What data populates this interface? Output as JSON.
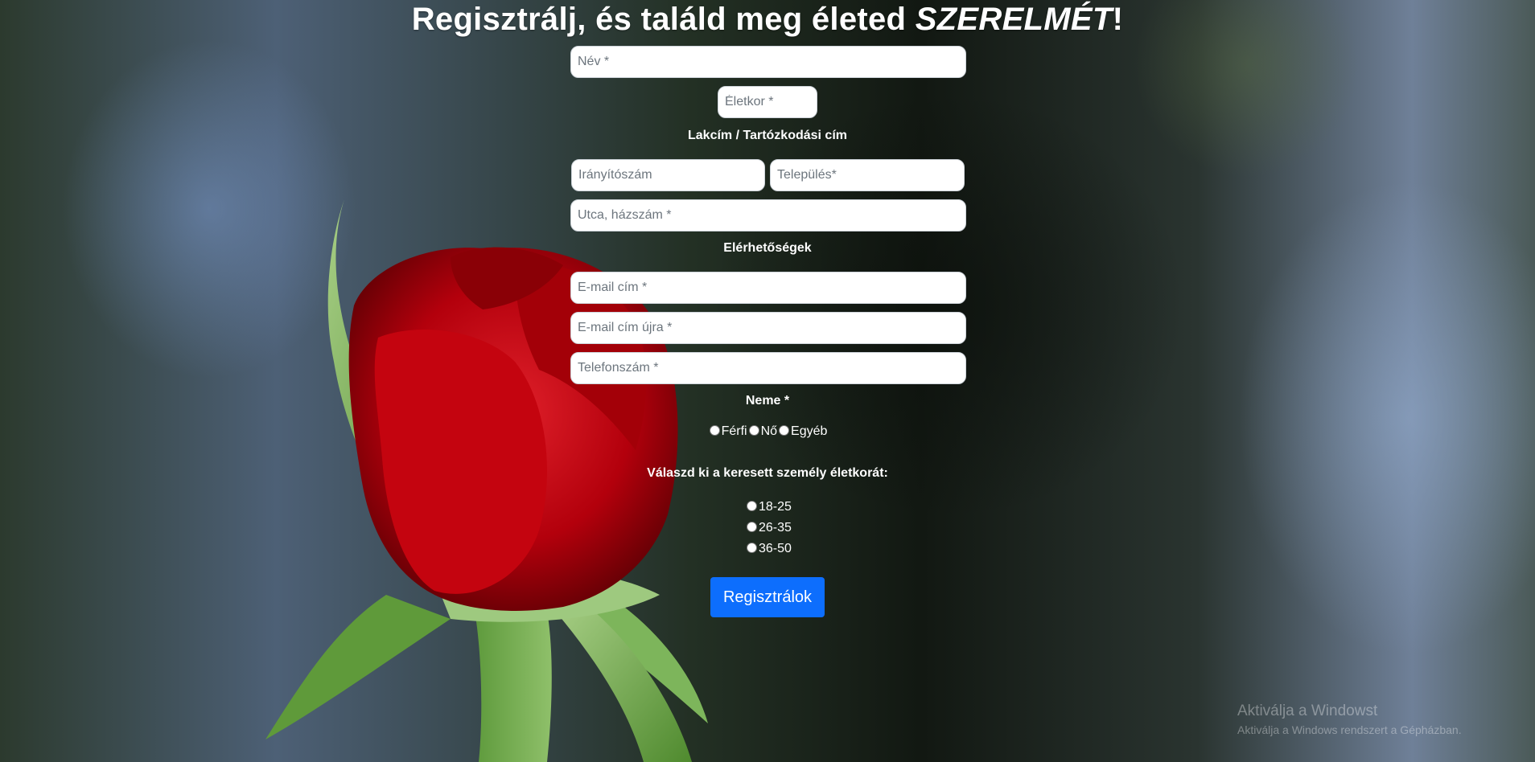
{
  "form": {
    "heading_prefix": "Regisztrálj, és találd meg életed ",
    "heading_emphasis": "SZERELMÉT",
    "heading_suffix": "!",
    "name_placeholder": "Név *",
    "age_placeholder": "Életkor *",
    "address_label": "Lakcím / Tartózkodási cím",
    "zip_placeholder": "Irányítószám",
    "city_placeholder": "Település*",
    "street_placeholder": "Utca, házszám *",
    "contact_label": "Elérhetőségek",
    "email_placeholder": "E-mail cím *",
    "email_again_placeholder": "E-mail cím újra *",
    "phone_placeholder": "Telefonszám *",
    "gender_label": "Neme *",
    "gender_options": [
      "Férfi",
      "Nő",
      "Egyéb"
    ],
    "seek_age_label": "Válaszd ki a keresett személy életkorát:",
    "seek_age_options": [
      "18-25",
      "26-35",
      "36-50"
    ],
    "submit_label": "Regisztrálok"
  },
  "watermark": {
    "title": "Aktiválja a Windowst",
    "subtitle": "Aktiválja a Windows rendszert a Gépházban."
  },
  "colors": {
    "primary_button": "#0d6efd",
    "text": "#ffffff"
  }
}
